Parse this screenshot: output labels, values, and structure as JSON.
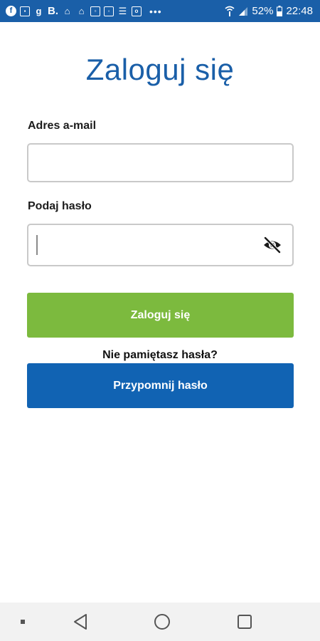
{
  "status_bar": {
    "left_text": "B.",
    "overflow_dots": "•••",
    "battery": "52%",
    "time": "22:48",
    "background_color": "#1a5fa8",
    "left_icons": [
      "facebook-icon",
      "gallery-icon",
      "app-g-icon",
      "booking-icon",
      "home-icon",
      "home-alt-icon",
      "screenshot-icon",
      "instagram-icon",
      "list-icon",
      "outlook-icon"
    ]
  },
  "login": {
    "title": "Zaloguj się",
    "email_label": "Adres a-mail",
    "email_value": "",
    "password_label": "Podaj hasło",
    "password_value": "",
    "login_button": "Zaloguj się",
    "forgot_text": "Nie pamiętasz hasła?",
    "remind_button": "Przypomnij hasło",
    "title_color": "#1a5fa8",
    "login_button_color": "#7cba3e",
    "remind_button_color": "#1163b3"
  },
  "nav_bar": {
    "items": [
      "dot-icon",
      "back-icon",
      "home-circle-icon",
      "recents-icon"
    ]
  }
}
